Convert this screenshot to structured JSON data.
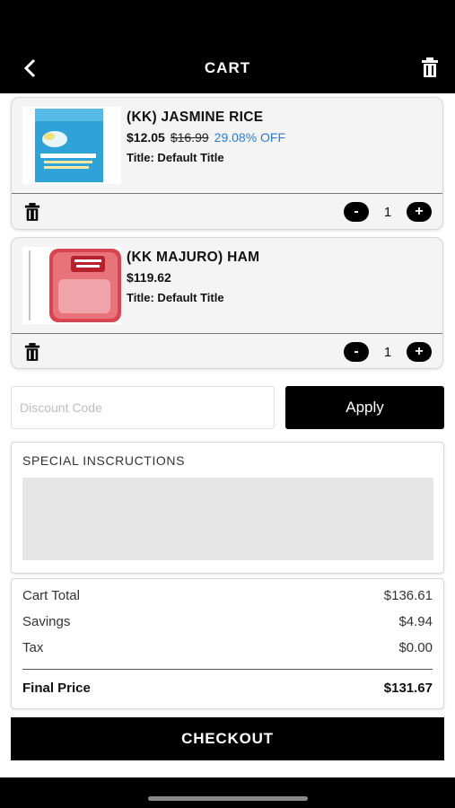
{
  "header": {
    "title": "CART",
    "back_icon": "chevron-left-icon",
    "clear_icon": "trash-icon"
  },
  "cart_items": [
    {
      "name": "(KK) JASMINE RICE",
      "price": "$12.05",
      "original_price": "$16.99",
      "discount": "29.08% OFF",
      "variant": "Title: Default Title",
      "quantity": "1",
      "minus": "-",
      "plus": "+",
      "image": "rice-bag-image"
    },
    {
      "name": "(KK MAJURO) HAM",
      "price": "$119.62",
      "original_price": "",
      "discount": "",
      "variant": "Title: Default Title",
      "quantity": "1",
      "minus": "-",
      "plus": "+",
      "image": "ham-package-image"
    }
  ],
  "discount": {
    "placeholder": "Discount Code",
    "apply_label": "Apply"
  },
  "special_instructions": {
    "label": "SPECIAL INSCRUCTIONS"
  },
  "summary": {
    "cart_total_label": "Cart Total",
    "cart_total_value": "$136.61",
    "savings_label": "Savings",
    "savings_value": "$4.94",
    "tax_label": "Tax",
    "tax_value": "$0.00",
    "final_label": "Final Price",
    "final_value": "$131.67"
  },
  "checkout_label": "CHECKOUT",
  "colors": {
    "accent": "#000000",
    "discount_blue": "#2b7bd6"
  }
}
